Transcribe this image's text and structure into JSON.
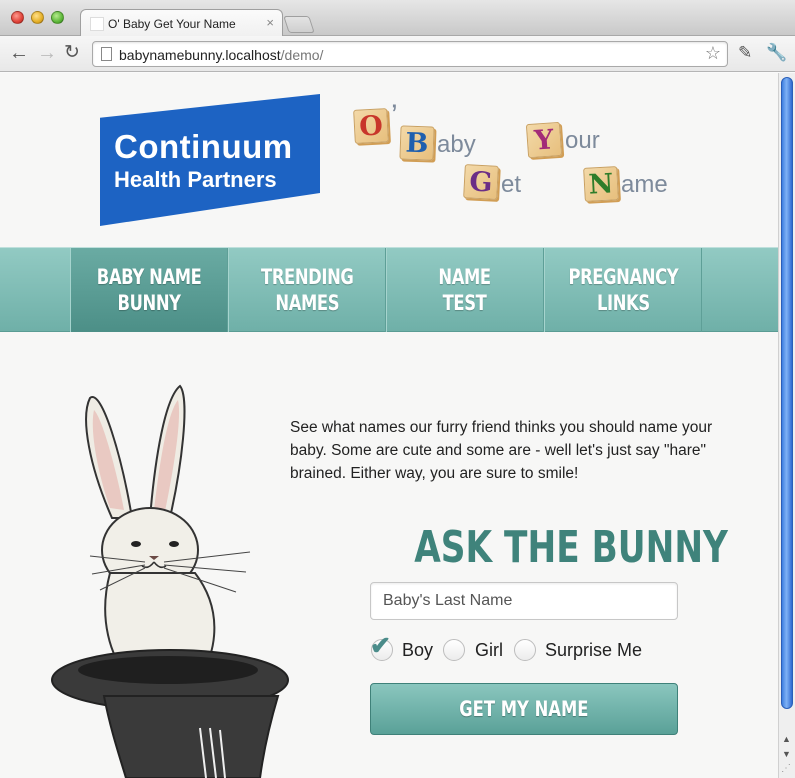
{
  "browser": {
    "tab_title": "O' Baby Get Your Name",
    "tab_close": "×",
    "url_host": "babynamebunny.localhost",
    "url_path": "/demo/",
    "back_icon": "←",
    "forward_icon": "→",
    "reload_icon": "↻",
    "star_icon": "☆",
    "pen_icon": "✎",
    "wrench_icon": "🔧"
  },
  "header": {
    "logo_line1": "Continuum",
    "logo_line2": "Health Partners",
    "logo_color": "#1d63c3",
    "tagline": {
      "o_letter": "O",
      "o_apostrophe": "’",
      "b_letter": "B",
      "b_rest": "aby",
      "y_letter": "Y",
      "y_rest": "our",
      "g_letter": "G",
      "g_rest": "et",
      "n_letter": "N",
      "n_rest": "ame"
    }
  },
  "nav": {
    "items": [
      {
        "label": "BABY NAME\nBUNNY",
        "active": true
      },
      {
        "label": "TRENDING\nNAMES",
        "active": false
      },
      {
        "label": "NAME\nTEST",
        "active": false
      },
      {
        "label": "PREGNANCY\nLINKS",
        "active": false
      }
    ],
    "color": "#7dbbb3"
  },
  "main": {
    "intro": "See what names our furry friend thinks you should name your baby. Some are cute and some are - well let's just say \"hare\" brained. Either way, you are sure to smile!",
    "ask_title": "ASK THE BUNNY",
    "last_name_placeholder": "Baby's Last Name",
    "gender_options": [
      {
        "label": "Boy",
        "checked": true
      },
      {
        "label": "Girl",
        "checked": false
      },
      {
        "label": "Surprise Me",
        "checked": false
      }
    ],
    "submit_label": "GET MY NAME",
    "accent": "#3f837b"
  }
}
